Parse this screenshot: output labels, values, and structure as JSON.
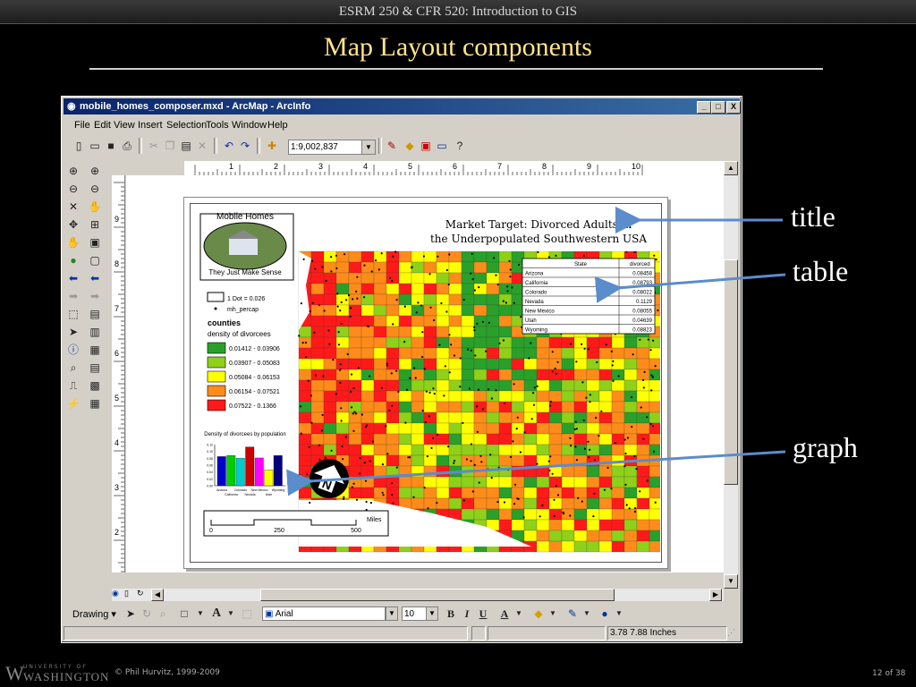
{
  "slide": {
    "header": "ESRM 250 & CFR 520: Introduction to GIS",
    "title": "Map Layout components",
    "labels": {
      "title": "title",
      "table": "table",
      "graph": "graph"
    },
    "footer_org": "WASHINGTON",
    "footer_org_small": "UNIVERSITY OF",
    "copyright": "© Phil Hurvitz, 1999-2009",
    "page": "12 of 38"
  },
  "window": {
    "title": "mobile_homes_composer.mxd - ArcMap - ArcInfo",
    "controls": {
      "minimize": "_",
      "maximize": "□",
      "close": "X"
    }
  },
  "menu": [
    "File",
    "Edit",
    "View",
    "Insert",
    "Selection",
    "Tools",
    "Window",
    "Help"
  ],
  "toolbar": {
    "scale": "1:9,002,837"
  },
  "ruler_top": [
    "1",
    "2",
    "3",
    "4",
    "5",
    "6",
    "7",
    "8",
    "9",
    "10"
  ],
  "ruler_left": [
    "9",
    "8",
    "7",
    "6",
    "5",
    "4",
    "3",
    "2",
    "1"
  ],
  "layout": {
    "map_title_line1": "Market Target: Divorced Adults in",
    "map_title_line2": "the Underpopulated Southwestern USA",
    "logo_top": "Mobile Homes",
    "logo_bottom": "They Just Make Sense",
    "legend": {
      "dot": "1 Dot = 0.026",
      "dot_field": "mh_percap",
      "layer": "counties",
      "field": "density of divorcees",
      "classes": [
        {
          "label": "0.01412 - 0.03906",
          "color": "#2aa02a"
        },
        {
          "label": "0.03907 - 0.05083",
          "color": "#8fd01a"
        },
        {
          "label": "0.05084 - 0.06153",
          "color": "#ffff00"
        },
        {
          "label": "0.06154 - 0.07521",
          "color": "#ff8c1a"
        },
        {
          "label": "0.07522 - 0.1366",
          "color": "#ff1a1a"
        }
      ]
    },
    "table": {
      "headers": [
        "State",
        "divorced"
      ],
      "rows": [
        [
          "Arizona",
          "0.08458"
        ],
        [
          "California",
          "0.08793"
        ],
        [
          "Colorado",
          "0.08022"
        ],
        [
          "Nevada",
          "0.1129"
        ],
        [
          "New Mexico",
          "0.08055"
        ],
        [
          "Utah",
          "0.04639"
        ],
        [
          "Wyoming",
          "0.08823"
        ]
      ]
    },
    "scalebar": {
      "ticks": [
        "0",
        "250",
        "500"
      ],
      "unit": "Miles"
    }
  },
  "chart_data": {
    "type": "bar",
    "title": "Density of divorcees by population",
    "categories": [
      "Arizona",
      "California",
      "Colorado",
      "Nevada",
      "New Mexico",
      "Utah",
      "Wyoming"
    ],
    "x_tick_labels_row1": [
      "Arizona",
      "Colorado",
      "New Mexico",
      "Wyoming"
    ],
    "x_tick_labels_row2": [
      "California",
      "Nevada",
      "Utah"
    ],
    "values": [
      0.085,
      0.088,
      0.08,
      0.113,
      0.081,
      0.046,
      0.088
    ],
    "colors": [
      "#0000cc",
      "#00cc00",
      "#00cccc",
      "#cc0000",
      "#ff00ff",
      "#ffff00",
      "#000080"
    ],
    "ylim": [
      0,
      0.12
    ],
    "yticks": [
      "0.12",
      "0.10",
      "0.08",
      "0.06",
      "0.04",
      "0.02",
      "0.00"
    ]
  },
  "drawing_toolbar": {
    "drawing_label": "Drawing ▾",
    "font": "Arial",
    "font_size": "10",
    "bold": "B",
    "italic": "I",
    "underline": "U",
    "font_color": "A"
  },
  "status": {
    "coords": "3.78  7.88 Inches"
  },
  "colors": {
    "title_accent": "#ffe58a",
    "arrow": "#5b8ccc",
    "window_title": "#0a246a"
  }
}
